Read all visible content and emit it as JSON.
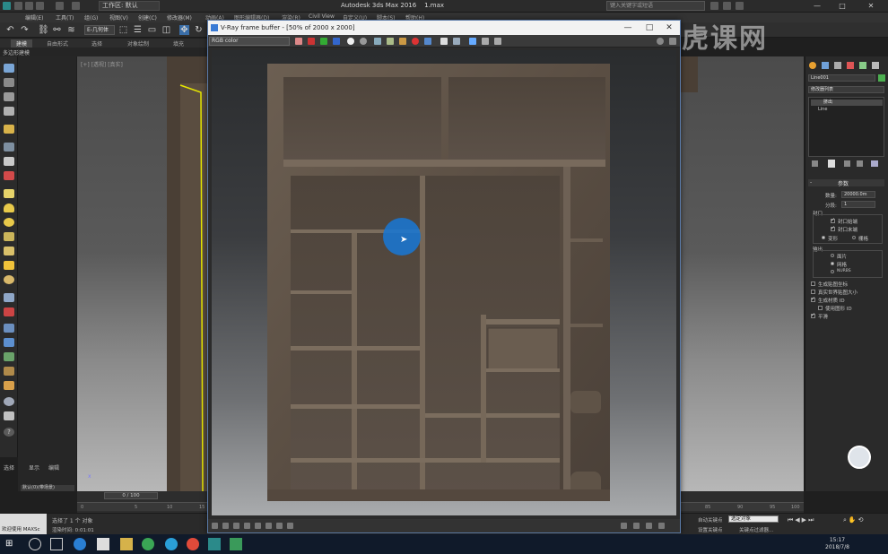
{
  "app": {
    "title": "Autodesk 3ds Max 2016",
    "file": "1.max",
    "workspace": "工作区: 默认",
    "search_placeholder": "键入关键字或短语",
    "window_buttons": [
      "—",
      "□",
      "✕"
    ]
  },
  "menu": [
    "编辑(E)",
    "工具(T)",
    "组(G)",
    "视图(V)",
    "创建(C)",
    "修改器(M)",
    "动画(A)",
    "图形编辑器(D)",
    "渲染(R)",
    "Civil View",
    "自定义(U)",
    "脚本(S)",
    "帮助(H)"
  ],
  "toolbar": {
    "selection_filter": "E-几何体"
  },
  "ribbon": {
    "tabs": [
      "建模",
      "自由形式",
      "选择",
      "对象绘制",
      "填充"
    ],
    "subtitle": "多边形建模"
  },
  "explorer": {
    "tabs": [
      "选择",
      "显示",
      "编辑"
    ],
    "item": "默认(0)(带场景)"
  },
  "viewport": {
    "label": "[+] [透视] [真实]"
  },
  "vfb": {
    "title": "V-Ray frame buffer - [50% of 2000 x 2000]",
    "channel": "RGB color"
  },
  "cmdpanel": {
    "object_name": "Line001",
    "modifier_list": "修改器列表",
    "stack": [
      "挤出",
      "Line"
    ],
    "rollout": "参数",
    "amount_label": "数量:",
    "amount_value": "20000.0m",
    "segments_label": "分段:",
    "segments_value": "1",
    "cap_title": "封口",
    "cap_start": "封口始端",
    "cap_end": "封口末端",
    "morph": "变形",
    "grid": "栅格",
    "output_title": "输出",
    "patch": "面片",
    "mesh": "网格",
    "nurbs": "NURBS",
    "gen_mapping": "生成贴图坐标",
    "real_world": "真实世界贴图大小",
    "gen_mat_ids": "生成材质 ID",
    "use_shape_ids": "使用图形 ID",
    "smooth": "平滑"
  },
  "timeline": {
    "frame": "0 / 100",
    "ticks": [
      "0",
      "5",
      "10",
      "15",
      "20",
      "25",
      "30",
      "35",
      "40",
      "45",
      "50",
      "55",
      "60",
      "65",
      "70",
      "75",
      "80",
      "85",
      "90",
      "95",
      "100"
    ]
  },
  "status": {
    "maxscript": "欢迎使用 MAXSc",
    "selected": "选择了 1 个 对象",
    "render_time": "渲染时间: 0:01:01",
    "autokey": "自动关键点",
    "selected_objects": "选定对象",
    "set_key": "设置关键点",
    "key_filters": "关键点过滤器..."
  },
  "taskbar": {
    "time": "15:17",
    "date": "2018/7/8"
  },
  "watermark": "虎课网"
}
